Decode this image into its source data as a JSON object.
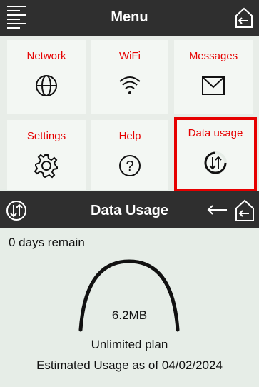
{
  "header": {
    "title": "Menu",
    "menu_icon": "menu-lines-icon",
    "home_icon": "home-back-icon"
  },
  "tiles": [
    {
      "label": "Network",
      "icon": "globe-icon"
    },
    {
      "label": "WiFi",
      "icon": "wifi-icon"
    },
    {
      "label": "Messages",
      "icon": "envelope-icon"
    },
    {
      "label": "Settings",
      "icon": "gear-icon"
    },
    {
      "label": "Help",
      "icon": "help-circle-icon"
    },
    {
      "label": "Data usage",
      "icon": "data-usage-icon",
      "selected": true
    }
  ],
  "data_usage": {
    "title": "Data Usage",
    "days_remaining": "0 days remain",
    "amount": "6.2MB",
    "plan": "Unlimited plan",
    "estimate": "Estimated Usage as of 04/02/2024"
  },
  "colors": {
    "header_bg": "#2f2f2f",
    "tile_label": "#e60000",
    "selection": "#e60000",
    "background": "#e6ede7"
  }
}
